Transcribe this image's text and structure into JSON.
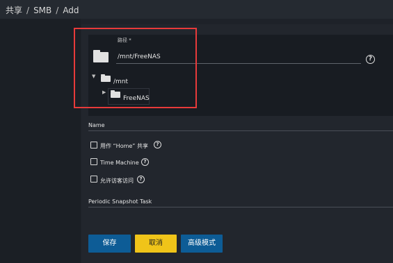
{
  "breadcrumb": {
    "items": [
      "共享",
      "SMB",
      "Add"
    ],
    "separator": "/"
  },
  "path_field": {
    "label": "路径 *",
    "value": "/mnt/FreeNAS",
    "help_icon": "help-circle-icon"
  },
  "tree": {
    "root": {
      "label": "/mnt",
      "expanded": true
    },
    "child": {
      "label": "FreeNAS",
      "expanded": false
    }
  },
  "name_field": {
    "label": "Name",
    "value": ""
  },
  "checkboxes": [
    {
      "label": "用作 “Home” 共享",
      "checked": false
    },
    {
      "label": "Time Machine",
      "checked": false
    },
    {
      "label": "允许访客访问",
      "checked": false
    }
  ],
  "snapshot_field": {
    "label": "Periodic Snapshot Task",
    "value": ""
  },
  "buttons": {
    "save": "保存",
    "cancel": "取消",
    "advanced": "高级模式"
  },
  "colors": {
    "primary": "#0d5c96",
    "cancel": "#f0c419",
    "highlight": "#e83a3a",
    "background": "#1e2229"
  }
}
